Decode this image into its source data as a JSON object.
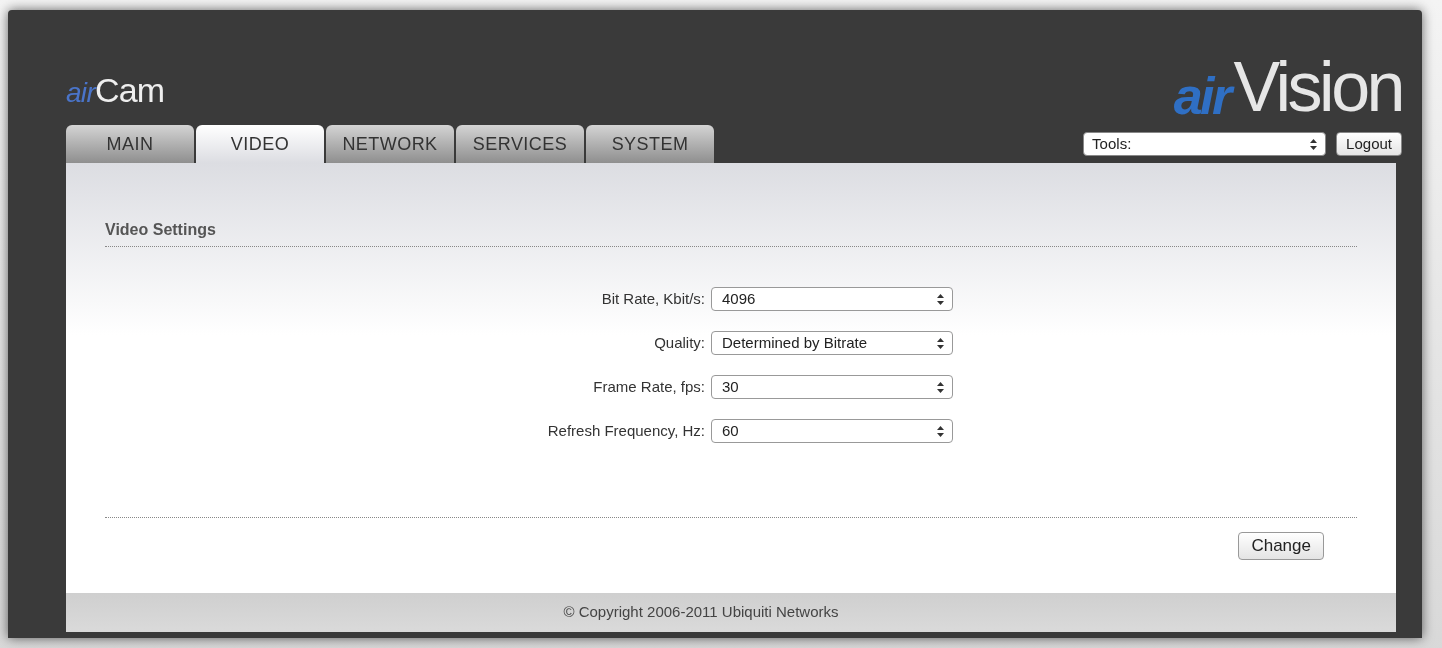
{
  "header": {
    "logo_left": {
      "prefix": "air",
      "name": "Cam"
    },
    "logo_right": {
      "prefix": "air",
      "name": "Vision"
    },
    "tools": {
      "value": "Tools:"
    },
    "logout": "Logout"
  },
  "tabs": [
    {
      "label": "MAIN",
      "selected": false
    },
    {
      "label": "VIDEO",
      "selected": true
    },
    {
      "label": "NETWORK",
      "selected": false
    },
    {
      "label": "SERVICES",
      "selected": false
    },
    {
      "label": "SYSTEM",
      "selected": false
    }
  ],
  "section_title": "Video Settings",
  "fields": [
    {
      "label": "Bit Rate, Kbit/s:",
      "value": "4096"
    },
    {
      "label": "Quality:",
      "value": "Determined by Bitrate"
    },
    {
      "label": "Frame Rate, fps:",
      "value": "30"
    },
    {
      "label": "Refresh Frequency, Hz:",
      "value": "60"
    }
  ],
  "change_button": "Change",
  "footer": "© Copyright 2006-2011 Ubiquiti Networks"
}
